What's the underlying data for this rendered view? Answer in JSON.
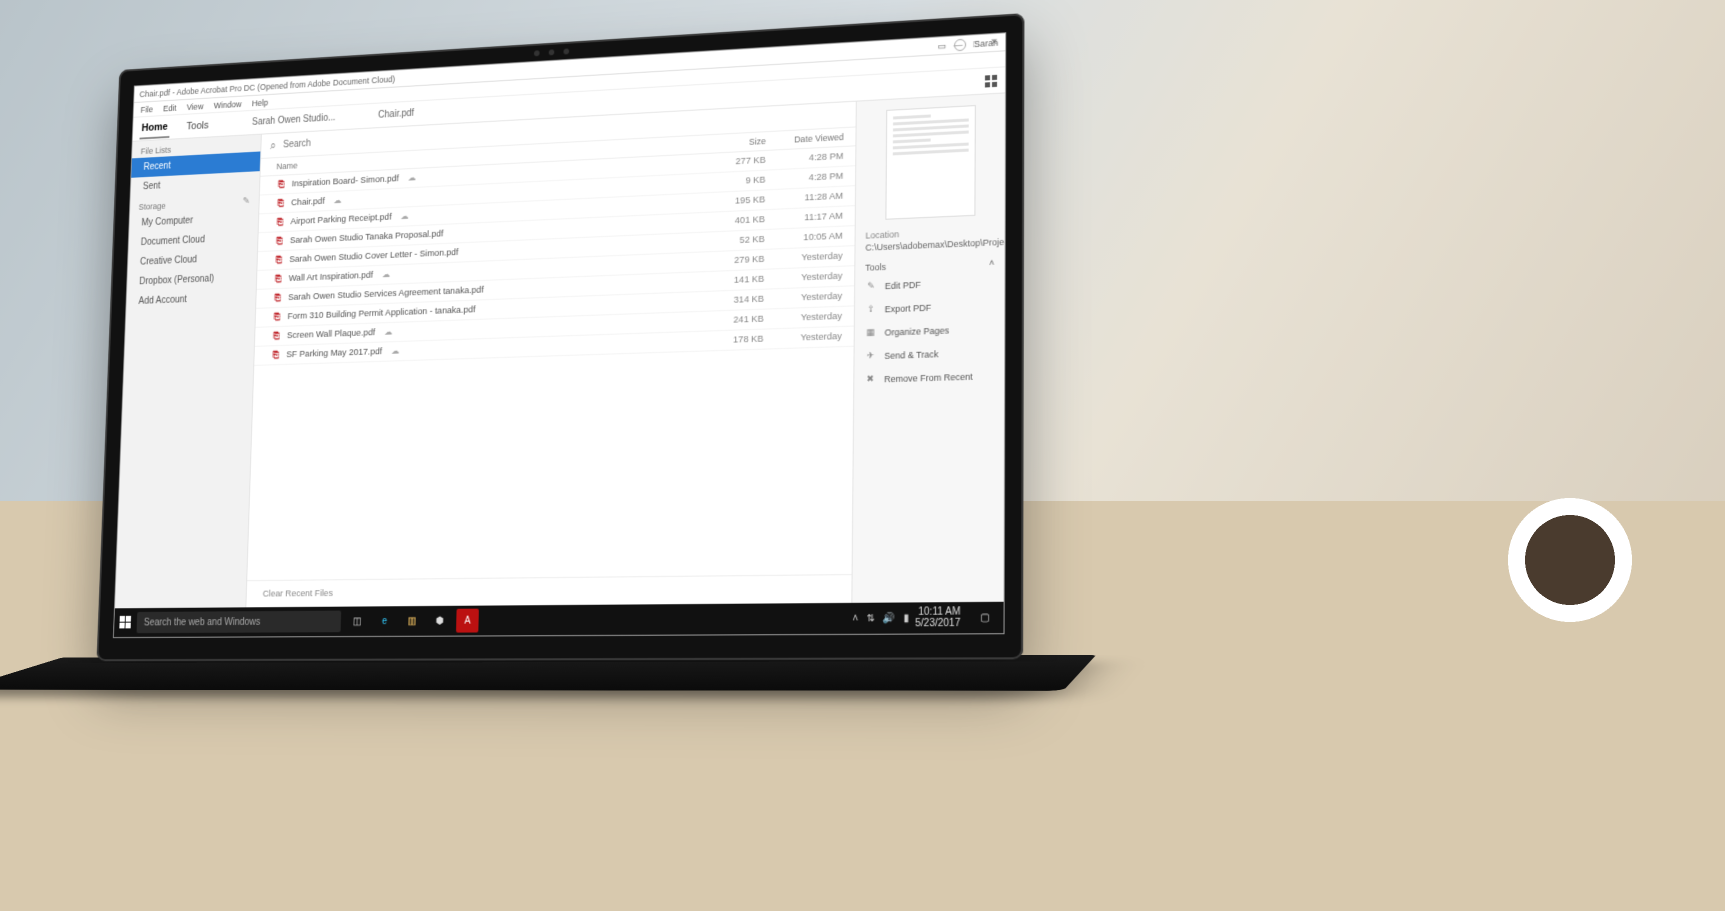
{
  "window": {
    "title": "Chair.pdf - Adobe Acrobat Pro DC (Opened from Adobe Document Cloud)",
    "user": "Sarah"
  },
  "menus": [
    "File",
    "Edit",
    "View",
    "Window",
    "Help"
  ],
  "toolbar": {
    "home": "Home",
    "tools": "Tools",
    "doc1": "Sarah Owen Studio...",
    "doc2": "Chair.pdf"
  },
  "search": {
    "placeholder": "Search"
  },
  "sidebar": {
    "listsHeading": "File Lists",
    "lists": [
      {
        "label": "Recent",
        "active": true
      },
      {
        "label": "Sent",
        "active": false
      }
    ],
    "storageHeading": "Storage",
    "storage": [
      "My Computer",
      "Document Cloud",
      "Creative Cloud",
      "Dropbox (Personal)",
      "Add Account"
    ]
  },
  "columns": {
    "name": "Name",
    "size": "Size",
    "date": "Date Viewed"
  },
  "files": [
    {
      "name": "Inspiration Board- Simon.pdf",
      "size": "277 KB",
      "date": "4:28 PM",
      "cloud": true
    },
    {
      "name": "Chair.pdf",
      "size": "9 KB",
      "date": "4:28 PM",
      "cloud": true
    },
    {
      "name": "Airport Parking Receipt.pdf",
      "size": "195 KB",
      "date": "11:28 AM",
      "cloud": true
    },
    {
      "name": "Sarah Owen Studio Tanaka Proposal.pdf",
      "size": "401 KB",
      "date": "11:17 AM",
      "cloud": false
    },
    {
      "name": "Sarah Owen Studio Cover Letter - Simon.pdf",
      "size": "52 KB",
      "date": "10:05 AM",
      "cloud": false
    },
    {
      "name": "Wall Art Inspiration.pdf",
      "size": "279 KB",
      "date": "Yesterday",
      "cloud": true
    },
    {
      "name": "Sarah Owen Studio Services Agreement tanaka.pdf",
      "size": "141 KB",
      "date": "Yesterday",
      "cloud": false
    },
    {
      "name": "Form 310 Building Permit Application - tanaka.pdf",
      "size": "314 KB",
      "date": "Yesterday",
      "cloud": false
    },
    {
      "name": "Screen Wall Plaque.pdf",
      "size": "241 KB",
      "date": "Yesterday",
      "cloud": true
    },
    {
      "name": "SF Parking May 2017.pdf",
      "size": "178 KB",
      "date": "Yesterday",
      "cloud": true
    }
  ],
  "clearRecent": "Clear Recent Files",
  "details": {
    "locationHeading": "Location",
    "locationPath": "C:\\Users\\adobemax\\Desktop\\Projects",
    "toolsHeading": "Tools",
    "tools": [
      {
        "icon": "✎",
        "label": "Edit PDF"
      },
      {
        "icon": "⇪",
        "label": "Export PDF"
      },
      {
        "icon": "▦",
        "label": "Organize Pages"
      },
      {
        "icon": "✈",
        "label": "Send & Track"
      },
      {
        "icon": "✖",
        "label": "Remove From Recent"
      }
    ]
  },
  "taskbar": {
    "search": "Search the web and Windows",
    "time": "10:11 AM",
    "date": "5/23/2017"
  }
}
